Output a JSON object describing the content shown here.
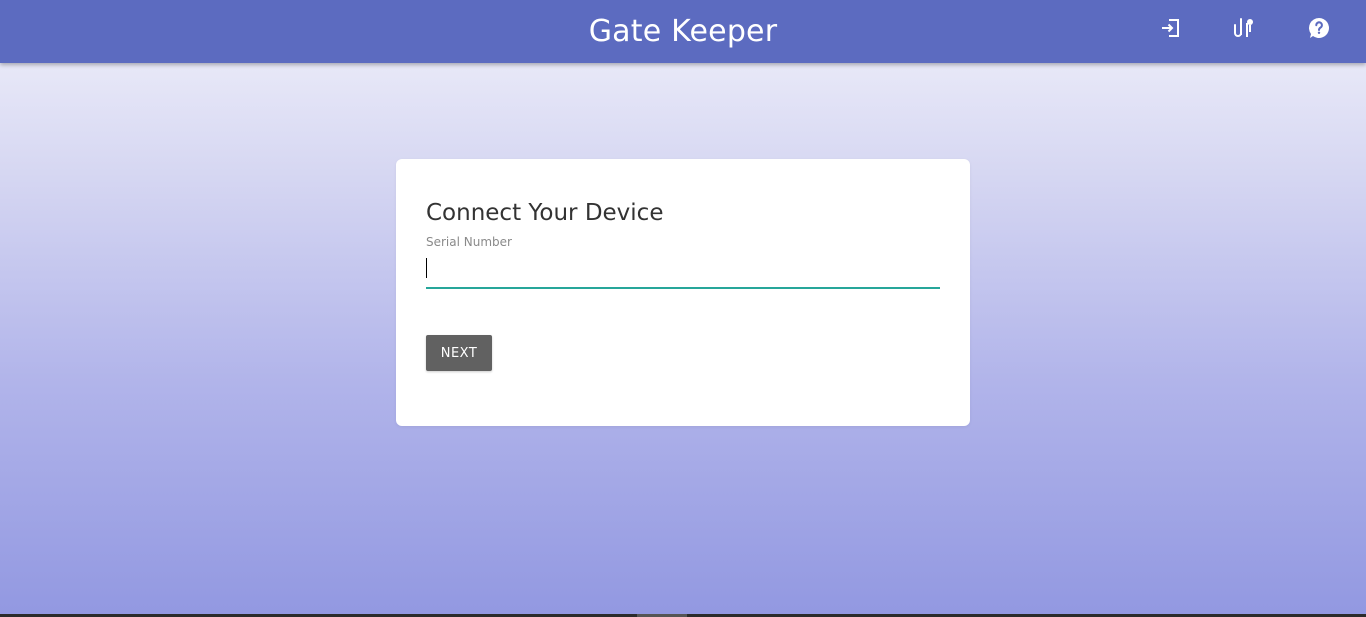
{
  "app": {
    "title": "Gate Keeper",
    "header_color": "#5c6bc0",
    "actions": [
      {
        "icon": "login-icon"
      },
      {
        "icon": "device-settings-icon"
      },
      {
        "icon": "help-icon"
      }
    ]
  },
  "connect_card": {
    "title": "Connect Your Device",
    "serial_field": {
      "label": "Serial Number",
      "value": "",
      "underline_color": "#26a69a"
    },
    "next_button_label": "NEXT"
  }
}
